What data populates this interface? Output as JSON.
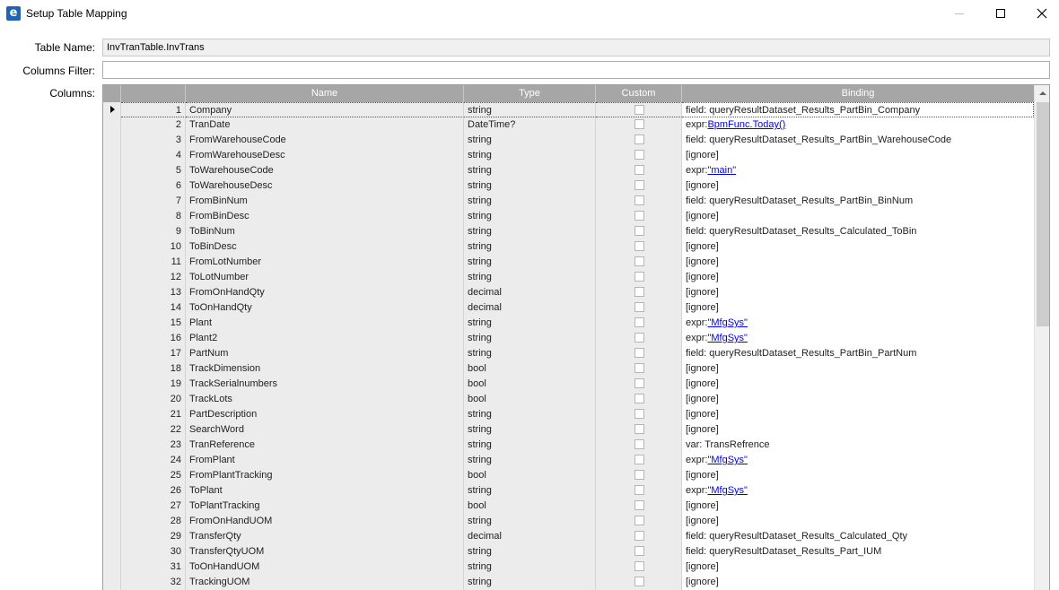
{
  "window": {
    "title": "Setup Table Mapping",
    "icon": "e-logo-icon"
  },
  "form": {
    "table_name_label": "Table Name:",
    "table_name_value": "InvTranTable.InvTrans",
    "columns_filter_label": "Columns Filter:",
    "columns_filter_value": "",
    "columns_label": "Columns:"
  },
  "grid": {
    "headers": [
      "Name",
      "Type",
      "Custom",
      "Binding"
    ],
    "rows": [
      {
        "num": "1",
        "name": "Company",
        "type": "string",
        "custom": false,
        "binding_prefix": "field: queryResultDataset_Results_PartBin_Company",
        "binding_link": ""
      },
      {
        "num": "2",
        "name": "TranDate",
        "type": "DateTime?",
        "custom": false,
        "binding_prefix": "expr:",
        "binding_link": "BpmFunc.Today()"
      },
      {
        "num": "3",
        "name": "FromWarehouseCode",
        "type": "string",
        "custom": false,
        "binding_prefix": "field: queryResultDataset_Results_PartBin_WarehouseCode",
        "binding_link": ""
      },
      {
        "num": "4",
        "name": "FromWarehouseDesc",
        "type": "string",
        "custom": false,
        "binding_prefix": "[ignore]",
        "binding_link": ""
      },
      {
        "num": "5",
        "name": "ToWarehouseCode",
        "type": "string",
        "custom": false,
        "binding_prefix": "expr:",
        "binding_link": "\"main\""
      },
      {
        "num": "6",
        "name": "ToWarehouseDesc",
        "type": "string",
        "custom": false,
        "binding_prefix": "[ignore]",
        "binding_link": ""
      },
      {
        "num": "7",
        "name": "FromBinNum",
        "type": "string",
        "custom": false,
        "binding_prefix": "field: queryResultDataset_Results_PartBin_BinNum",
        "binding_link": ""
      },
      {
        "num": "8",
        "name": "FromBinDesc",
        "type": "string",
        "custom": false,
        "binding_prefix": "[ignore]",
        "binding_link": ""
      },
      {
        "num": "9",
        "name": "ToBinNum",
        "type": "string",
        "custom": false,
        "binding_prefix": "field: queryResultDataset_Results_Calculated_ToBin",
        "binding_link": ""
      },
      {
        "num": "10",
        "name": "ToBinDesc",
        "type": "string",
        "custom": false,
        "binding_prefix": "[ignore]",
        "binding_link": ""
      },
      {
        "num": "11",
        "name": "FromLotNumber",
        "type": "string",
        "custom": false,
        "binding_prefix": "[ignore]",
        "binding_link": ""
      },
      {
        "num": "12",
        "name": "ToLotNumber",
        "type": "string",
        "custom": false,
        "binding_prefix": "[ignore]",
        "binding_link": ""
      },
      {
        "num": "13",
        "name": "FromOnHandQty",
        "type": "decimal",
        "custom": false,
        "binding_prefix": "[ignore]",
        "binding_link": ""
      },
      {
        "num": "14",
        "name": "ToOnHandQty",
        "type": "decimal",
        "custom": false,
        "binding_prefix": "[ignore]",
        "binding_link": ""
      },
      {
        "num": "15",
        "name": "Plant",
        "type": "string",
        "custom": false,
        "binding_prefix": "expr:",
        "binding_link": "\"MfgSys\""
      },
      {
        "num": "16",
        "name": "Plant2",
        "type": "string",
        "custom": false,
        "binding_prefix": "expr:",
        "binding_link": "\"MfgSys\""
      },
      {
        "num": "17",
        "name": "PartNum",
        "type": "string",
        "custom": false,
        "binding_prefix": "field: queryResultDataset_Results_PartBin_PartNum",
        "binding_link": ""
      },
      {
        "num": "18",
        "name": "TrackDimension",
        "type": "bool",
        "custom": false,
        "binding_prefix": "[ignore]",
        "binding_link": ""
      },
      {
        "num": "19",
        "name": "TrackSerialnumbers",
        "type": "bool",
        "custom": false,
        "binding_prefix": "[ignore]",
        "binding_link": ""
      },
      {
        "num": "20",
        "name": "TrackLots",
        "type": "bool",
        "custom": false,
        "binding_prefix": "[ignore]",
        "binding_link": ""
      },
      {
        "num": "21",
        "name": "PartDescription",
        "type": "string",
        "custom": false,
        "binding_prefix": "[ignore]",
        "binding_link": ""
      },
      {
        "num": "22",
        "name": "SearchWord",
        "type": "string",
        "custom": false,
        "binding_prefix": "[ignore]",
        "binding_link": ""
      },
      {
        "num": "23",
        "name": "TranReference",
        "type": "string",
        "custom": false,
        "binding_prefix": "var: TransRefrence",
        "binding_link": ""
      },
      {
        "num": "24",
        "name": "FromPlant",
        "type": "string",
        "custom": false,
        "binding_prefix": "expr:",
        "binding_link": "\"MfgSys\""
      },
      {
        "num": "25",
        "name": "FromPlantTracking",
        "type": "bool",
        "custom": false,
        "binding_prefix": "[ignore]",
        "binding_link": ""
      },
      {
        "num": "26",
        "name": "ToPlant",
        "type": "string",
        "custom": false,
        "binding_prefix": "expr:",
        "binding_link": "\"MfgSys\""
      },
      {
        "num": "27",
        "name": "ToPlantTracking",
        "type": "bool",
        "custom": false,
        "binding_prefix": "[ignore]",
        "binding_link": ""
      },
      {
        "num": "28",
        "name": "FromOnHandUOM",
        "type": "string",
        "custom": false,
        "binding_prefix": "[ignore]",
        "binding_link": ""
      },
      {
        "num": "29",
        "name": "TransferQty",
        "type": "decimal",
        "custom": false,
        "binding_prefix": "field: queryResultDataset_Results_Calculated_Qty",
        "binding_link": ""
      },
      {
        "num": "30",
        "name": "TransferQtyUOM",
        "type": "string",
        "custom": false,
        "binding_prefix": "field: queryResultDataset_Results_Part_IUM",
        "binding_link": ""
      },
      {
        "num": "31",
        "name": "ToOnHandUOM",
        "type": "string",
        "custom": false,
        "binding_prefix": "[ignore]",
        "binding_link": ""
      },
      {
        "num": "32",
        "name": "TrackingUOM",
        "type": "string",
        "custom": false,
        "binding_prefix": "[ignore]",
        "binding_link": ""
      }
    ]
  },
  "colors": {
    "header_bg": "#a6a6a6",
    "readonly_cell_bg": "#ececec",
    "link": "#0000ee",
    "scroll_thumb": "#cdcdcd"
  }
}
